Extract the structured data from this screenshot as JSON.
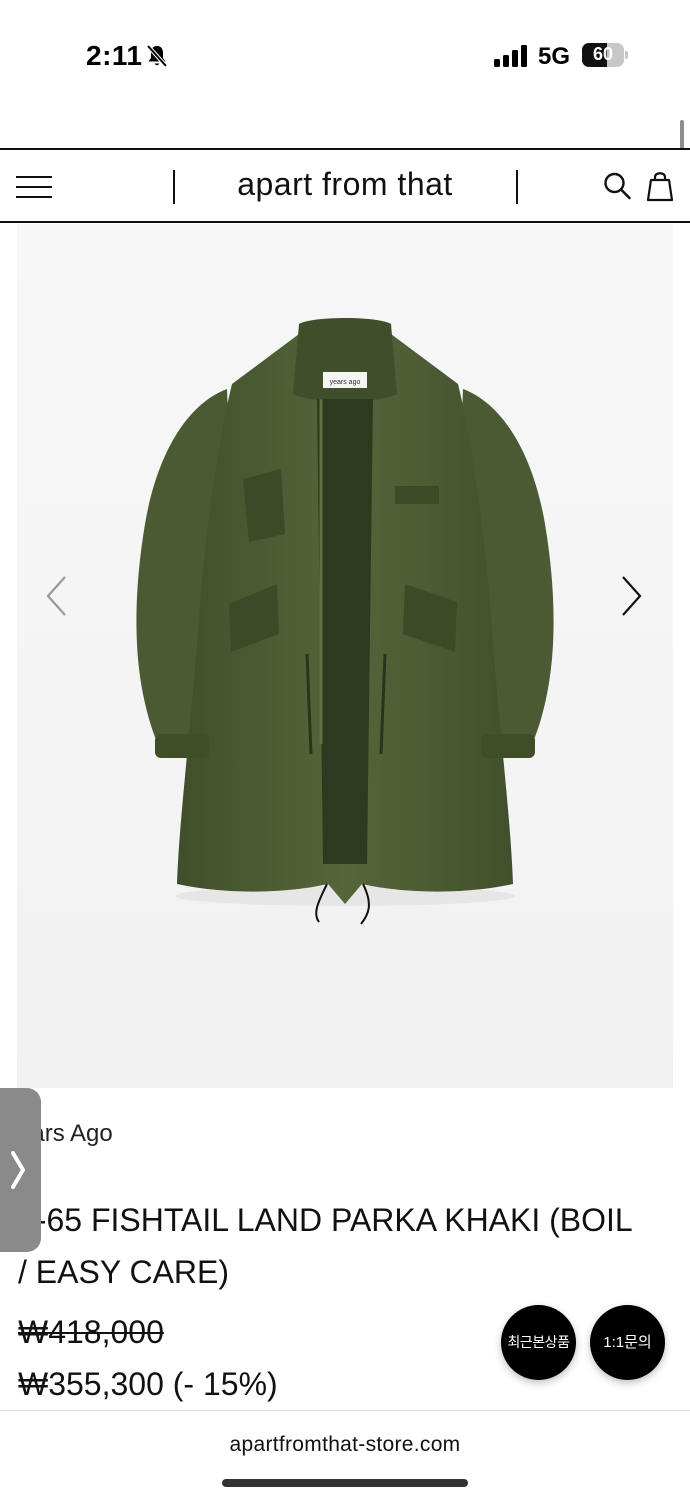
{
  "status_bar": {
    "time": "2:11",
    "network": "5G",
    "battery_level": "60",
    "battery_fraction": 0.6
  },
  "header": {
    "brand_logo": "apart from that"
  },
  "product": {
    "brand": "ears Ago",
    "title": "1-65 FISHTAIL LAND PARKA KHAKI (BOIL / EASY CARE)",
    "original_price": "₩418,000",
    "sale_price": "₩355,300 (- 15%)",
    "image_label": "years ago"
  },
  "floating_buttons": {
    "recent_items": "최근본상품",
    "inquiry": "1:1문의"
  },
  "browser": {
    "url": "apartfromthat-store.com"
  },
  "colors": {
    "parka_khaki": "#4a5a32",
    "fab_background": "#000000",
    "side_tab": "#8a8a8a"
  }
}
